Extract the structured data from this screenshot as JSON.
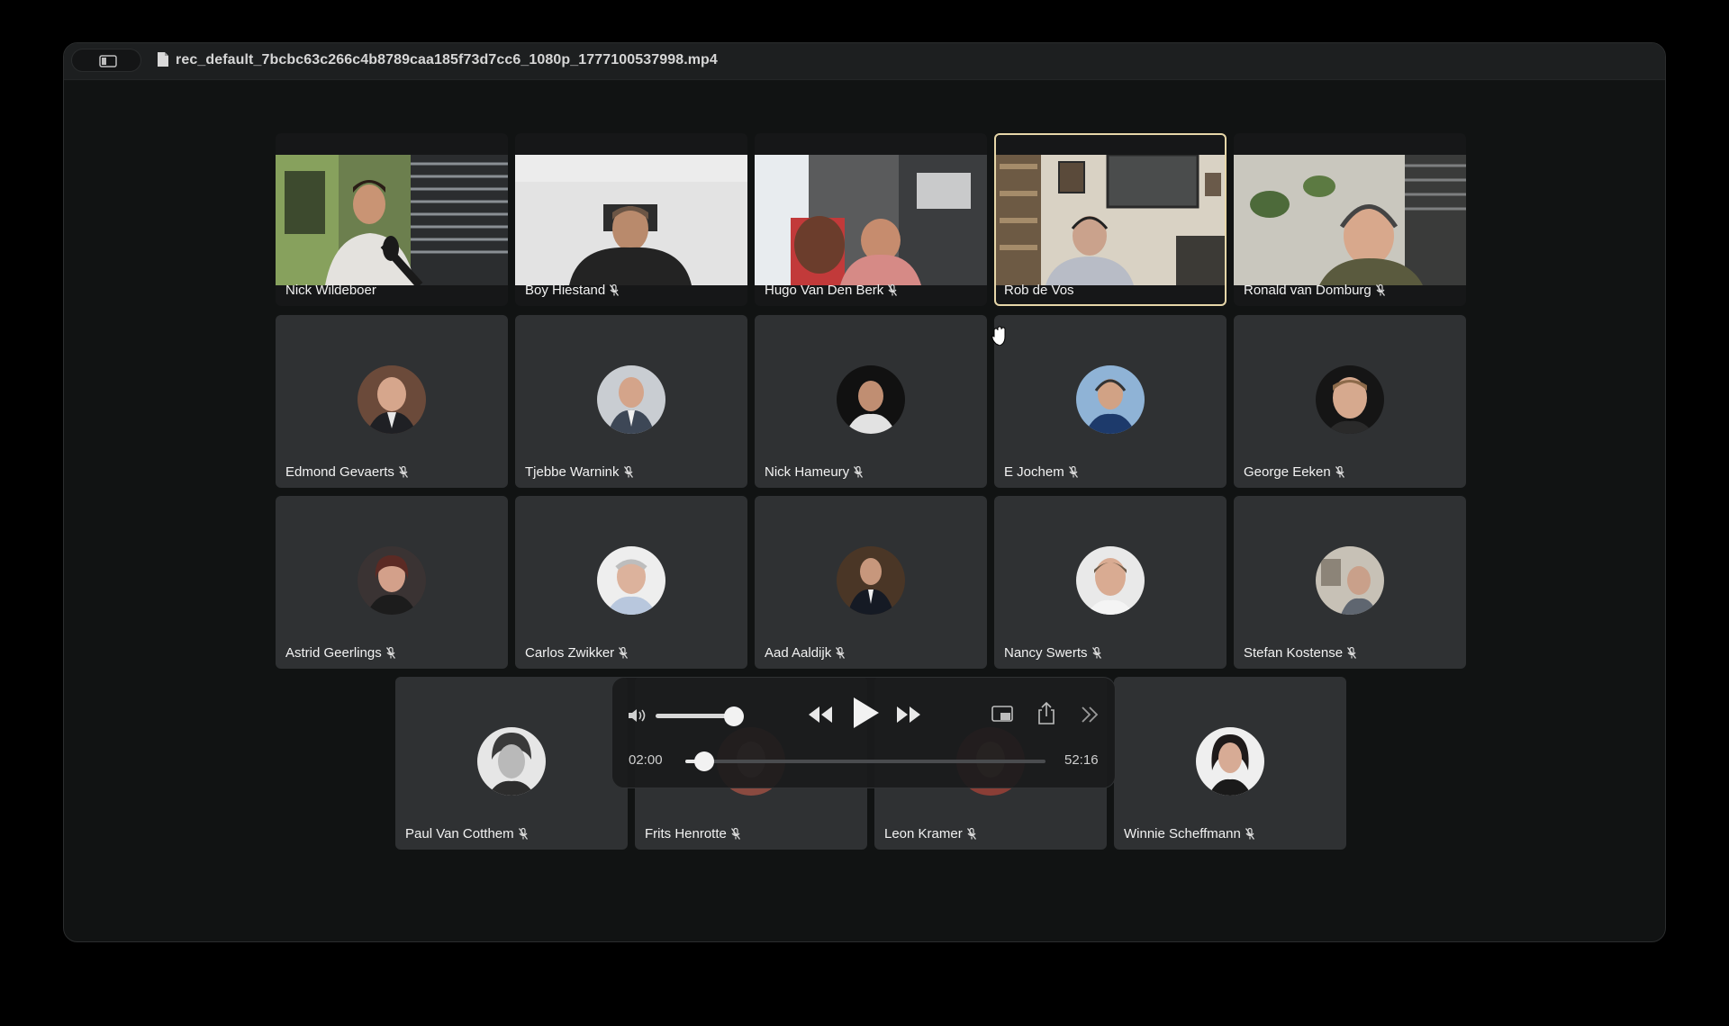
{
  "window": {
    "file_title": "rec_default_7bcbc63c266c4b8789caa185f73d7cc6_1080p_1777100537998.mp4"
  },
  "participants": [
    {
      "name": "Nick Wildeboer",
      "muted": false,
      "video": true
    },
    {
      "name": "Boy Hiestand",
      "muted": true,
      "video": true
    },
    {
      "name": "Hugo Van Den Berk",
      "muted": true,
      "video": true
    },
    {
      "name": "Rob de Vos",
      "muted": false,
      "video": true,
      "active_speaker": true
    },
    {
      "name": "Ronald van Domburg",
      "muted": true,
      "video": true
    },
    {
      "name": "Edmond Gevaerts",
      "muted": true
    },
    {
      "name": "Tjebbe Warnink",
      "muted": true
    },
    {
      "name": "Nick Hameury",
      "muted": true
    },
    {
      "name": "E Jochem",
      "muted": true
    },
    {
      "name": "George Eeken",
      "muted": true
    },
    {
      "name": "Astrid Geerlings",
      "muted": true
    },
    {
      "name": "Carlos Zwikker",
      "muted": true
    },
    {
      "name": "Aad Aaldijk",
      "muted": true
    },
    {
      "name": "Nancy Swerts",
      "muted": true
    },
    {
      "name": "Stefan Kostense",
      "muted": true
    },
    {
      "name": "Paul Van Cotthem",
      "muted": true
    },
    {
      "name": "Frits Henrotte",
      "muted": true
    },
    {
      "name": "Leon Kramer",
      "muted": true
    },
    {
      "name": "Winnie Scheffmann",
      "muted": true
    }
  ],
  "player": {
    "current_time": "02:00",
    "duration": "52:16",
    "progress": 0.038,
    "volume": 0.85,
    "state": "paused",
    "icons": [
      "speaker-icon",
      "rewind-icon",
      "play-icon",
      "fast-forward-icon",
      "picture-in-picture-icon",
      "share-icon",
      "more-icon"
    ]
  },
  "colors": {
    "background": "#000000",
    "window": "#111313",
    "tile": "#2f3133",
    "active_border": "#e6d6a8"
  }
}
